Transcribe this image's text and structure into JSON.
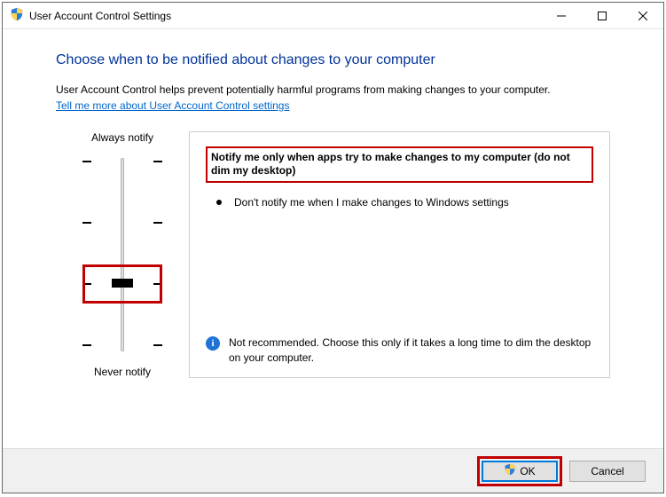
{
  "window": {
    "title": "User Account Control Settings"
  },
  "heading": "Choose when to be notified about changes to your computer",
  "description": "User Account Control helps prevent potentially harmful programs from making changes to your computer.",
  "help_link": "Tell me more about User Account Control settings",
  "slider": {
    "top_label": "Always notify",
    "bottom_label": "Never notify",
    "levels": 4,
    "selected_index": 2
  },
  "panel": {
    "heading": "Notify me only when apps try to make changes to my computer (do not dim my desktop)",
    "bullets": [
      "Don't notify me when I make changes to Windows settings"
    ],
    "recommendation": "Not recommended. Choose this only if it takes a long time to dim the desktop on your computer."
  },
  "buttons": {
    "ok": "OK",
    "cancel": "Cancel"
  }
}
